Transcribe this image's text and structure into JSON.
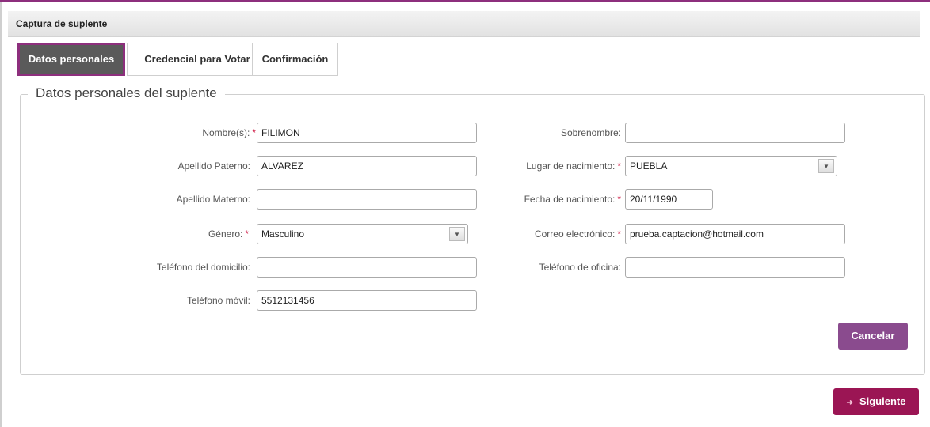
{
  "window": {
    "title": "Captura de suplente"
  },
  "tabs": [
    {
      "label": "Datos personales",
      "active": true
    },
    {
      "label": "Credencial para Votar",
      "active": false
    },
    {
      "label": "Confirmación",
      "active": false
    }
  ],
  "section": {
    "legend": "Datos personales del suplente"
  },
  "form": {
    "nombre": {
      "label": "Nombre(s):",
      "required": "*",
      "value": "FILIMON"
    },
    "apellido_paterno": {
      "label": "Apellido Paterno:",
      "value": "ALVAREZ"
    },
    "apellido_materno": {
      "label": "Apellido Materno:",
      "value": ""
    },
    "genero": {
      "label": "Género:",
      "required": "*",
      "value": "Masculino"
    },
    "telefono_domicilio": {
      "label": "Teléfono del domicilio:",
      "value": ""
    },
    "telefono_movil": {
      "label": "Teléfono móvil:",
      "value": "5512131456"
    },
    "sobrenombre": {
      "label": "Sobrenombre:",
      "value": ""
    },
    "lugar_nacimiento": {
      "label": "Lugar de nacimiento:",
      "required": "*",
      "value": "PUEBLA"
    },
    "fecha_nacimiento": {
      "label": "Fecha de nacimiento:",
      "required": "*",
      "value": "20/11/1990"
    },
    "correo": {
      "label": "Correo electrónico:",
      "required": "*",
      "value": "prueba.captacion@hotmail.com"
    },
    "telefono_oficina": {
      "label": "Teléfono de oficina:",
      "value": ""
    }
  },
  "buttons": {
    "cancel": "Cancelar",
    "next": "Siguiente",
    "next_icon": "arrow-right-icon"
  },
  "colors": {
    "accent": "#8d2f7d",
    "cancel": "#8a4b8e",
    "next": "#9b1554",
    "required": "#d0204a"
  }
}
